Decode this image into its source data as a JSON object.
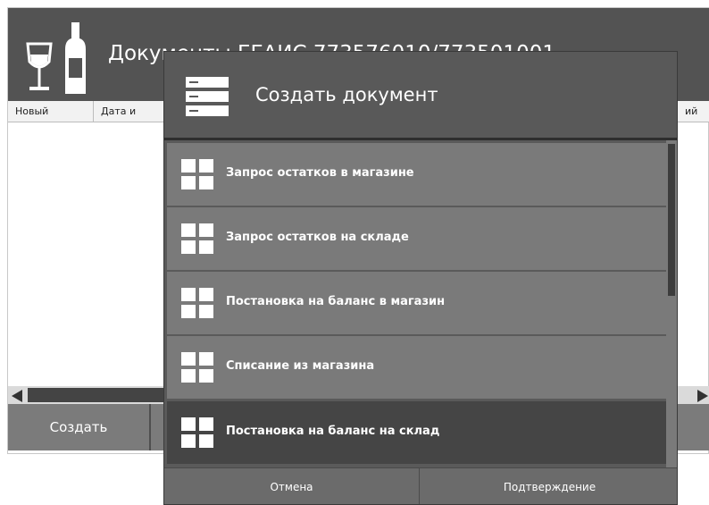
{
  "background_window": {
    "title": "Документы ЕГАИС 773576010/773501001",
    "columns": [
      "Новый",
      "Дата и",
      "ий"
    ],
    "create_button_label": "Создать"
  },
  "dialog": {
    "title": "Создать документ",
    "items": [
      {
        "label": "Запрос остатков в магазине"
      },
      {
        "label": "Запрос остатков на складе"
      },
      {
        "label": "Постановка на баланс в магазин"
      },
      {
        "label": "Списание из магазина"
      },
      {
        "label": "Постановка на баланс на склад"
      }
    ],
    "cancel_label": "Отмена",
    "confirm_label": "Подтверждение"
  },
  "icons": {
    "logo": "wine-bottle-glass-icon",
    "dialog": "list-document-icon",
    "item": "grid-icon",
    "scroll_left": "arrow-left-icon",
    "scroll_right": "arrow-right-icon"
  },
  "colors": {
    "header_bg": "#535353",
    "dialog_bg": "#595959",
    "item_bg": "#7a7a7a",
    "item_selected_bg": "#454545",
    "footer_bg": "#6b6b6b",
    "text_on_dark": "#ffffff"
  },
  "state": {
    "selected_item_index": 4,
    "list_scroll_fraction": 0.0
  }
}
